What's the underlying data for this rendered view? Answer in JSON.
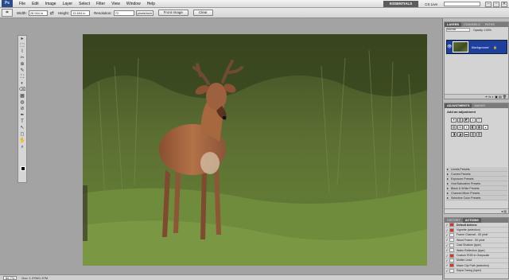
{
  "menubar": {
    "app_logo": "Ps",
    "items": [
      "File",
      "Edit",
      "Image",
      "Layer",
      "Select",
      "Filter",
      "View",
      "Window",
      "Help"
    ],
    "workspace_button": "ESSENTIALS",
    "cs_live": "CS Live",
    "window_buttons": [
      "–",
      "▫",
      "✕"
    ]
  },
  "options": {
    "width_label": "Width:",
    "width_value": "28.944 in",
    "swap_icon": "⇄",
    "height_label": "Height:",
    "height_value": "13.694 in",
    "resolution_label": "Resolution:",
    "resolution_value": "72",
    "resolution_unit": "pixels/inch",
    "front_image_label": "Front Image",
    "clear_label": "Clear"
  },
  "toolbox": {
    "tools": [
      "▸",
      "⬚",
      "⌇",
      "✂",
      "⊕",
      "✎",
      "⛶",
      "◐",
      "⌫",
      "▦",
      "◍",
      "⊘",
      "✒",
      "T",
      "↖",
      "◻",
      "✋",
      "⌕"
    ]
  },
  "status": {
    "zoom": "66.7%",
    "doc_size": "Doc: 1.37M/1.37M"
  },
  "layers_panel": {
    "tabs": [
      "LAYERS",
      "CHANNELS",
      "PATHS"
    ],
    "blend_mode": "Normal",
    "opacity": "Opacity: 100%",
    "layer_name": "Background",
    "footer_icons": "⚭ fx ◐ ▣ ▤ 🗑"
  },
  "adjustments_panel": {
    "tabs": [
      "ADJUSTMENTS",
      "MASKS"
    ],
    "title": "Add an adjustment",
    "icons_row1": [
      "☀",
      "▥",
      "◩",
      "±",
      "▽"
    ],
    "icons_row2": [
      "▤",
      "⚖",
      "◑",
      "◧",
      "▦",
      "◒"
    ],
    "icons_row3": [
      "◨",
      "◪",
      "▬",
      "▧",
      "▨"
    ],
    "presets": [
      "Levels Presets",
      "Curves Presets",
      "Exposure Presets",
      "Hue/Saturation Presets",
      "Black & White Presets",
      "Channel Mixer Presets",
      "Selective Color Presets"
    ],
    "footer_icons": "◂ ▤"
  },
  "actions_panel": {
    "tabs": [
      "HISTORY",
      "ACTIONS"
    ],
    "items": [
      {
        "label": "Default Actions",
        "set": true
      },
      {
        "label": "Vignette (selection)",
        "set": false
      },
      {
        "label": "Frame Channel - 50 pixel",
        "set": false
      },
      {
        "label": "Wood Frame - 50 pixel",
        "set": false
      },
      {
        "label": "Cast Shadow (type)",
        "set": false
      },
      {
        "label": "Water Reflection (type)",
        "set": false
      },
      {
        "label": "Custom RGB to Grayscale",
        "set": false
      },
      {
        "label": "Molten Lead",
        "set": false
      },
      {
        "label": "Make Clip Path (selection)",
        "set": false
      },
      {
        "label": "Sepia Toning (layer)",
        "set": false
      }
    ]
  },
  "colors": {
    "layer_selected": "#1e3f9e",
    "grass": "#5b6f2e",
    "deer": "#a5633e"
  }
}
